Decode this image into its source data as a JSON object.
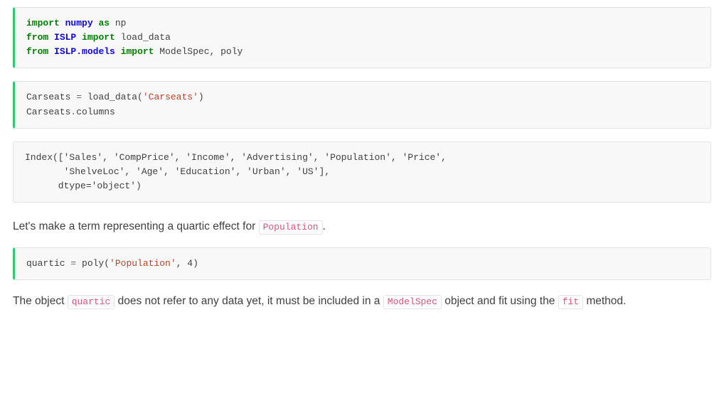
{
  "code1": {
    "l1": {
      "kw1": "import",
      "mod1": "numpy",
      "kw2": "as",
      "nm1": "np"
    },
    "l2": {
      "kw1": "from",
      "mod1": "ISLP",
      "kw2": "import",
      "nm1": "load_data"
    },
    "l3": {
      "kw1": "from",
      "mod1": "ISLP.models",
      "kw2": "import",
      "nm1": "ModelSpec",
      "comma": ", ",
      "nm2": "poly"
    }
  },
  "code2": {
    "l1": {
      "nm1": "Carseats",
      "op1": " = ",
      "fn": "load_data",
      "op2": "(",
      "str1": "'Carseats'",
      "op3": ")"
    },
    "l2": {
      "nm1": "Carseats",
      "op1": ".",
      "nm2": "columns"
    }
  },
  "output1": "Index(['Sales', 'CompPrice', 'Income', 'Advertising', 'Population', 'Price',\n       'ShelveLoc', 'Age', 'Education', 'Urban', 'US'],\n      dtype='object')",
  "prose1": {
    "t1": "Let's make a term representing a quartic effect for ",
    "c1": "Population",
    "t2": "."
  },
  "code3": {
    "l1": {
      "nm1": "quartic",
      "op1": " = ",
      "fn": "poly",
      "op2": "(",
      "str1": "'Population'",
      "comma": ", ",
      "num": "4",
      "op3": ")"
    }
  },
  "prose2": {
    "t1": "The object ",
    "c1": "quartic",
    "t2": " does not refer to any data yet, it must be included in a ",
    "c2": "ModelSpec",
    "t3": " object and fit using the ",
    "c3": "fit",
    "t4": " method."
  }
}
